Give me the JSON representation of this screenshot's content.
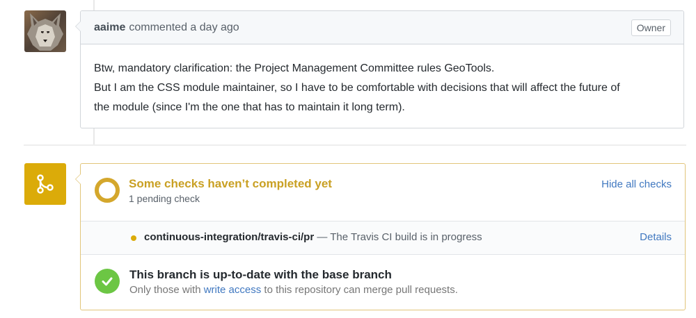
{
  "comment": {
    "author": "aaime",
    "action": "commented",
    "time": "a day ago",
    "badge": "Owner",
    "lines": [
      "Btw, mandatory clarification: the Project Management Committee rules GeoTools.",
      "But I am the CSS module maintainer, so I have to be comfortable with decisions that will affect the future of",
      "the module (since I'm the one that has to maintain it long term)."
    ]
  },
  "checks": {
    "title": "Some checks haven’t completed yet",
    "subtitle": "1 pending check",
    "toggle_label": "Hide all checks",
    "items": [
      {
        "name": "continuous-integration/travis-ci/pr",
        "separator": " — ",
        "description": "The Travis CI build is in progress",
        "status": "pending",
        "details_label": "Details"
      }
    ]
  },
  "branch": {
    "title": "This branch is up-to-date with the base branch",
    "sub_prefix": "Only those with ",
    "sub_link": "write access",
    "sub_suffix": " to this repository can merge pull requests."
  },
  "icons": {
    "avatar": "wolf-avatar",
    "merge": "git-merge-icon",
    "pending": "pending-ring-icon",
    "success": "check-icon"
  },
  "colors": {
    "pending": "#dbab09",
    "success": "#6cc644",
    "link": "#4078c0"
  }
}
